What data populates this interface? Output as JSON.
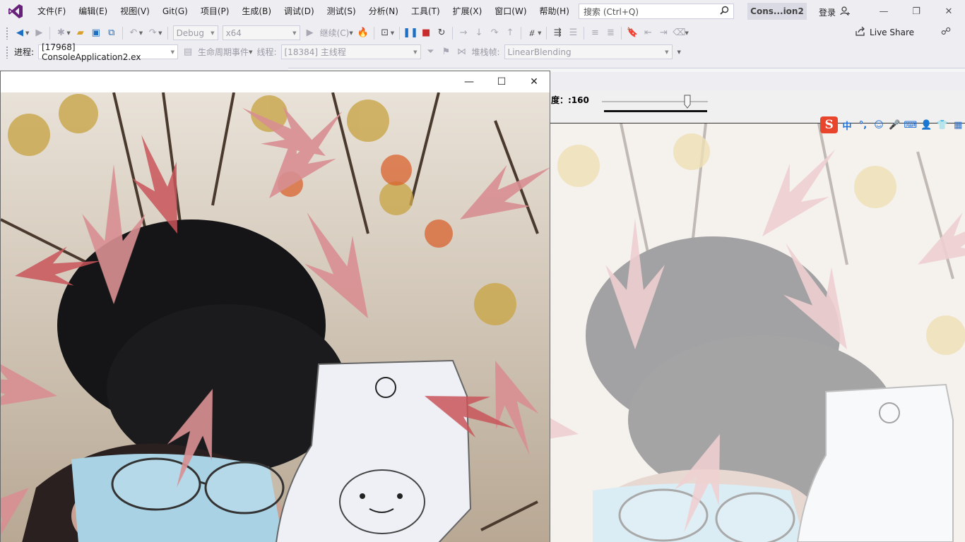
{
  "menubar": {
    "items": [
      "文件(F)",
      "编辑(E)",
      "视图(V)",
      "Git(G)",
      "项目(P)",
      "生成(B)",
      "调试(D)",
      "测试(S)",
      "分析(N)",
      "工具(T)",
      "扩展(X)",
      "窗口(W)",
      "帮助(H)"
    ],
    "search_placeholder": "搜索 (Ctrl+Q)",
    "solution_title": "Cons...ion2",
    "signin_label": "登录"
  },
  "toolbar1": {
    "config": "Debug",
    "platform": "x64",
    "continue_label": "继续(C)",
    "live_share_label": "Live Share"
  },
  "toolbar2": {
    "process_label": "进程:",
    "process_value": "[17968] ConsoleApplication2.ex",
    "lifecycle_label": "生命周期事件",
    "thread_label": "线程:",
    "thread_value": "[18384] 主线程",
    "stackframe_label": "堆栈帧:",
    "stackframe_value": "LinearBlending"
  },
  "image_window2": {
    "trackbar_caption": "度：:160",
    "trackbar_value": 160
  },
  "ime": {
    "logo": "S",
    "items": [
      "中",
      "°,",
      "☺",
      "🎤",
      "⌨",
      "👤",
      "👕",
      "▦"
    ]
  },
  "colors": {
    "accent": "#1c6fc5",
    "stop": "#c82b2b",
    "vs_purple": "#68217a",
    "ime_orange": "#e8452c"
  }
}
